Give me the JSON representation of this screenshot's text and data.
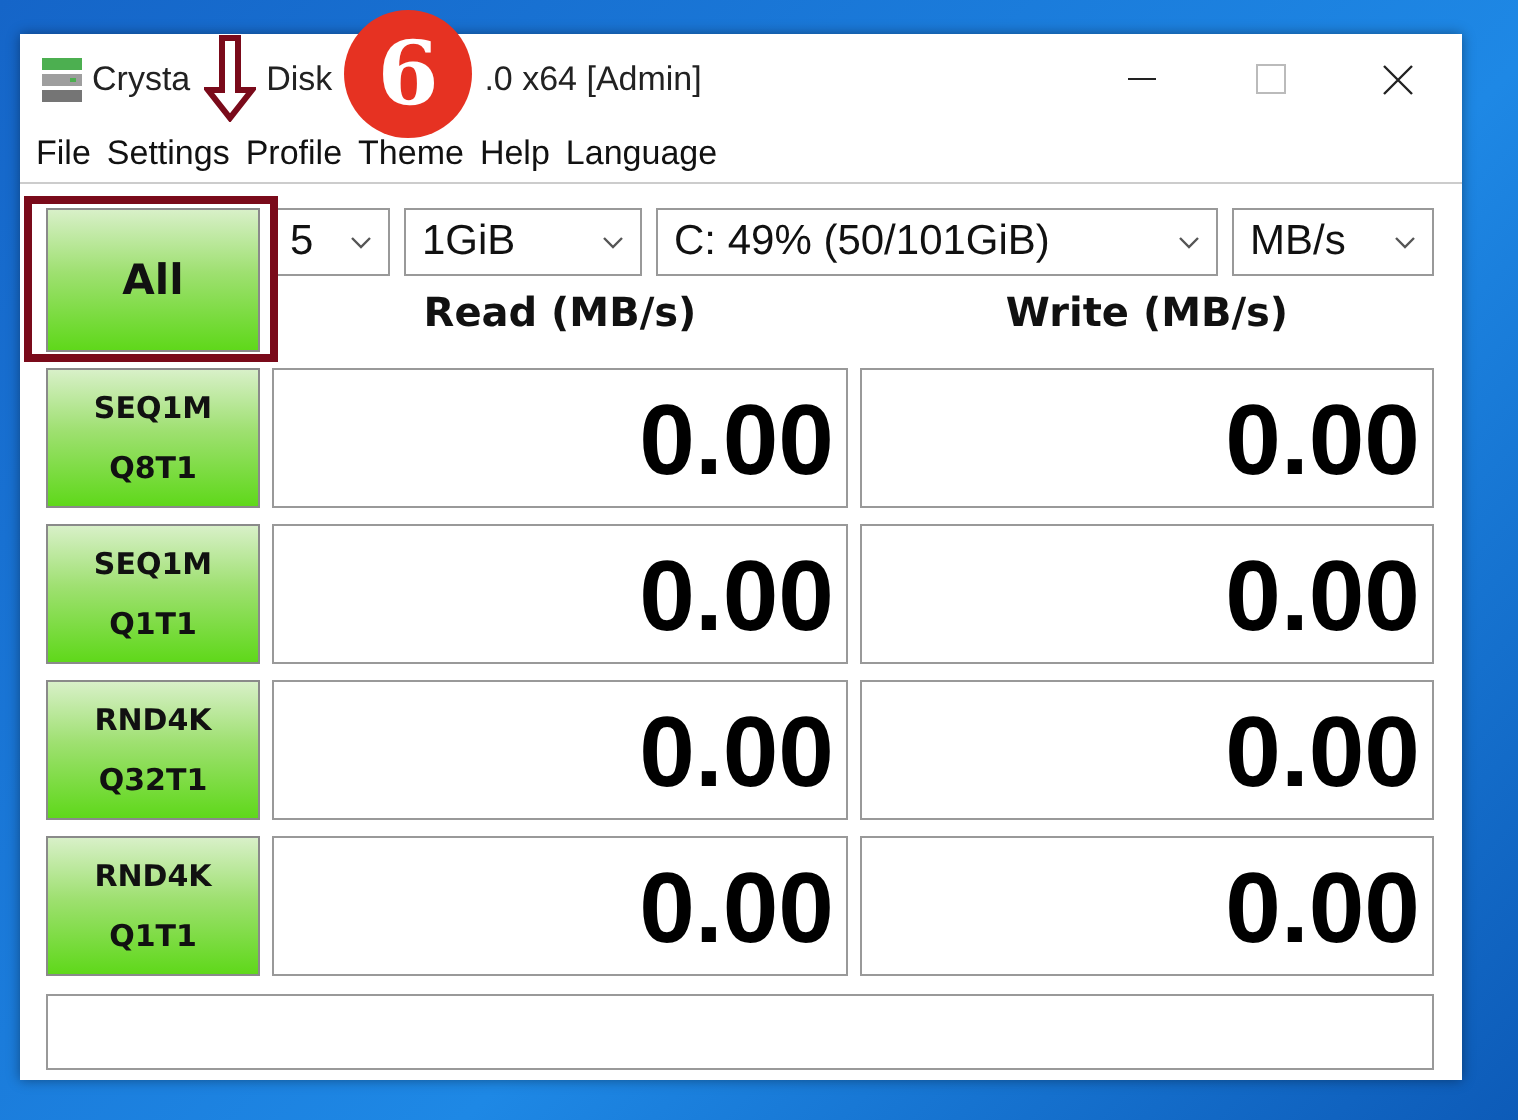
{
  "window": {
    "title_parts": [
      "Crysta",
      "Disk",
      ".0 x64 [Admin]"
    ]
  },
  "menu": [
    "File",
    "Settings",
    "Profile",
    "Theme",
    "Help",
    "Language"
  ],
  "all_button": {
    "label": "All"
  },
  "selectors": [
    {
      "value": "5"
    },
    {
      "value": "1GiB"
    },
    {
      "value": "C: 49% (50/101GiB)"
    },
    {
      "value": "MB/s"
    }
  ],
  "columns": [
    "Read (MB/s)",
    "Write (MB/s)"
  ],
  "tests": [
    {
      "line1": "SEQ1M",
      "line2": "Q8T1",
      "read": "0.00",
      "write": "0.00"
    },
    {
      "line1": "SEQ1M",
      "line2": "Q1T1",
      "read": "0.00",
      "write": "0.00"
    },
    {
      "line1": "RND4K",
      "line2": "Q32T1",
      "read": "0.00",
      "write": "0.00"
    },
    {
      "line1": "RND4K",
      "line2": "Q1T1",
      "read": "0.00",
      "write": "0.00"
    }
  ],
  "annotation": {
    "badge": "6"
  }
}
